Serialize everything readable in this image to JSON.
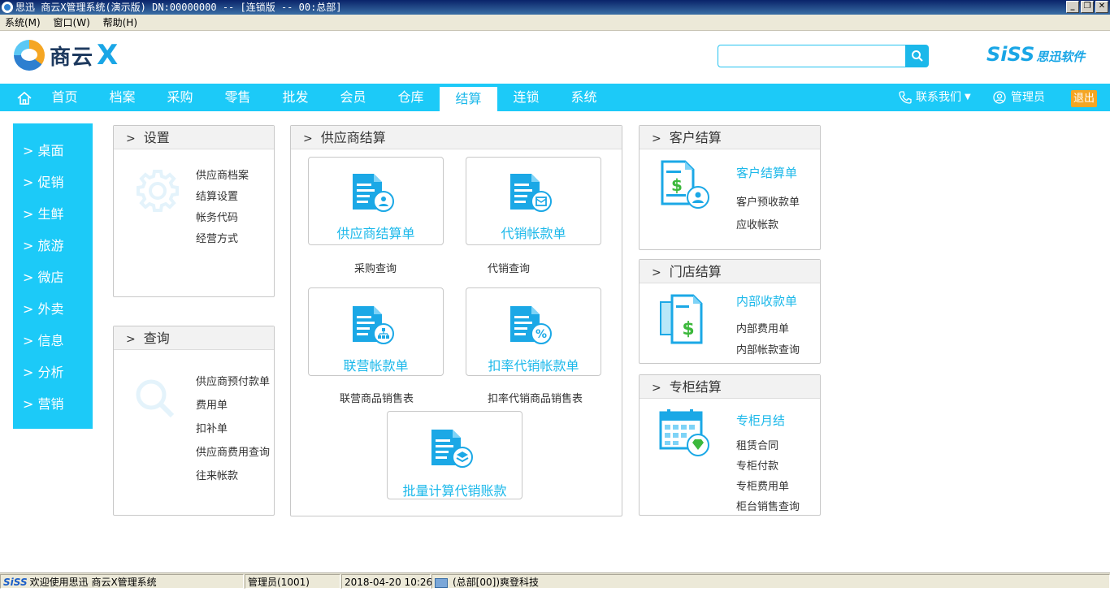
{
  "window": {
    "title": "思迅 商云X管理系统(演示版) DN:00000000 -- [连锁版 -- 00:总部]"
  },
  "menubar": [
    "系统(M)",
    "窗口(W)",
    "帮助(H)"
  ],
  "header": {
    "brand_cn": "商云",
    "brand_x": "X",
    "search_placeholder": "",
    "siss_en": "SiSS",
    "siss_cn": "思迅软件"
  },
  "nav": {
    "items": [
      "首页",
      "档案",
      "采购",
      "零售",
      "批发",
      "会员",
      "仓库",
      "结算",
      "连锁",
      "系统"
    ],
    "active": "结算",
    "contact": "联系我们",
    "admin": "管理员",
    "exit": "退出"
  },
  "sidebar": {
    "items": [
      "> 桌面",
      "> 促销",
      "> 生鲜",
      "> 旅游",
      "> 微店",
      "> 外卖",
      "> 信息",
      "> 分析",
      "> 营销"
    ]
  },
  "settings": {
    "title": "设置",
    "links": [
      "供应商档案",
      "结算设置",
      "帐务代码",
      "经营方式"
    ]
  },
  "query": {
    "title": "查询",
    "links": [
      "供应商预付款单",
      "费用单",
      "扣补单",
      "供应商费用查询",
      "往来帐款"
    ]
  },
  "supplier": {
    "title": "供应商结算",
    "cards": [
      "供应商结算单",
      "代销帐款单",
      "联营帐款单",
      "扣率代销帐款单",
      "批量计算代销账款"
    ],
    "sublinks": [
      "采购查询",
      "代销查询",
      "联营商品销售表",
      "扣率代销商品销售表"
    ]
  },
  "customer": {
    "title": "客户结算",
    "main": "客户结算单",
    "links": [
      "客户预收款单",
      "应收帐款"
    ]
  },
  "store": {
    "title": "门店结算",
    "main": "内部收款单",
    "links": [
      "内部费用单",
      "内部帐款查询"
    ]
  },
  "counter": {
    "title": "专柜结算",
    "main": "专柜月结",
    "links": [
      "租赁合同",
      "专柜付款",
      "专柜费用单",
      "柜台销售查询"
    ]
  },
  "status": {
    "siss": "SiSS",
    "welcome": "欢迎使用思迅 商云X管理系统",
    "user": "管理员(1001)",
    "datetime": "2018-04-20 10:26",
    "company": "(总部[00])爽登科技"
  },
  "colors": {
    "accent": "#1ccaf8",
    "accent_text": "#1bb8ea",
    "exit_button": "#f5a623"
  }
}
